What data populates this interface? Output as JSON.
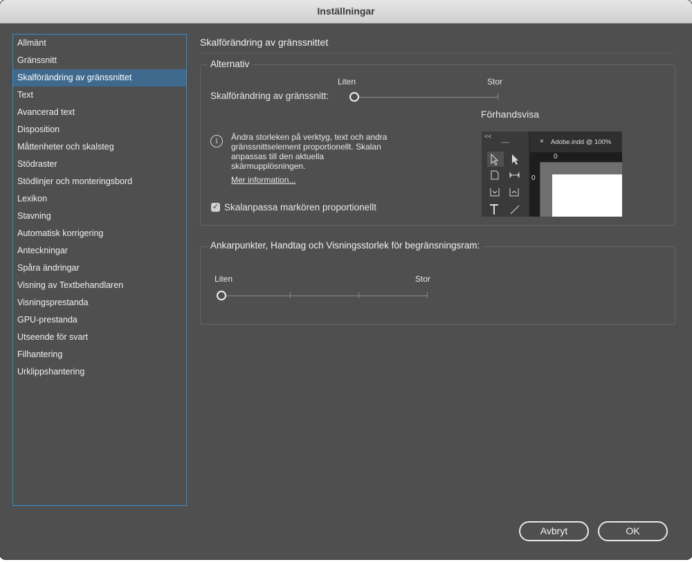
{
  "window": {
    "title": "Inställningar"
  },
  "sidebar": {
    "items": [
      {
        "label": "Allmänt"
      },
      {
        "label": "Gränssnitt"
      },
      {
        "label": "Skalförändring av gränssnittet",
        "selected": true
      },
      {
        "label": "Text"
      },
      {
        "label": "Avancerad text"
      },
      {
        "label": "Disposition"
      },
      {
        "label": "Måttenheter och skalsteg"
      },
      {
        "label": "Stödraster"
      },
      {
        "label": "Stödlinjer och monteringsbord"
      },
      {
        "label": "Lexikon"
      },
      {
        "label": "Stavning"
      },
      {
        "label": "Automatisk korrigering"
      },
      {
        "label": "Anteckningar"
      },
      {
        "label": "Spåra ändringar"
      },
      {
        "label": "Visning av Textbehandlaren"
      },
      {
        "label": "Visningsprestanda"
      },
      {
        "label": "GPU-prestanda"
      },
      {
        "label": "Utseende för svart"
      },
      {
        "label": "Filhantering"
      },
      {
        "label": "Urklippshantering"
      }
    ]
  },
  "main": {
    "title": "Skalförändring av gränssnittet",
    "options_group": {
      "legend": "Alternativ",
      "slider_min_label": "Liten",
      "slider_max_label": "Stor",
      "slider_label": "Skalförändring av gränssnitt:",
      "slider_value": 0,
      "preview_label": "Förhandsvisa",
      "info_text": "Ändra storleken på verktyg, text och andra gränssnittselement proportionellt. Skalan anpassas till den aktuella skärmupplösningen.",
      "info_lines": [
        "Ändra storleken på verktyg, text och andra",
        "gränssnittselement proportionellt. Skalan",
        "anpassas till den aktuella",
        "skärmupplösningen."
      ],
      "more_info_link": "Mer information...",
      "checkbox_label": "Skalanpassa markören proportionellt",
      "checkbox_checked": true
    },
    "anchor_group": {
      "legend": "Ankarpunkter, Handtag och Visningsstorlek för begränsningsram:",
      "slider_min_label": "Liten",
      "slider_max_label": "Stor",
      "slider_value": 0
    },
    "preview": {
      "collapse_glyph": "<<",
      "close_glyph": "×",
      "doc_tab": "Adobe.indd @ 100%",
      "ruler_zero_h": "0",
      "ruler_zero_v": "0"
    }
  },
  "footer": {
    "cancel_label": "Avbryt",
    "ok_label": "OK"
  },
  "colors": {
    "window_bg": "#4f4f4f",
    "selection": "#3f6a8e",
    "focus_ring": "#2e8fd0"
  }
}
